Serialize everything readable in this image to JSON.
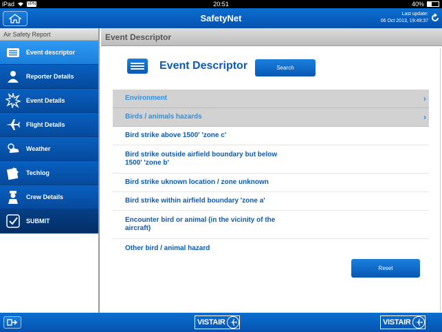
{
  "statusbar": {
    "device": "iPad",
    "vpn": "VPN",
    "time": "20:51",
    "battery": "40%",
    "battery_level": 0.4
  },
  "topbar": {
    "title": "SafetyNet",
    "update_label": "Last update:",
    "update_value": "06 Oct 2013, 19:49:37"
  },
  "sidebar": {
    "header": "Air Safety Report",
    "items": [
      {
        "label": "Event descriptor",
        "icon": "list-icon"
      },
      {
        "label": "Reporter Details",
        "icon": "reporter-icon"
      },
      {
        "label": "Event Details",
        "icon": "event-burst-icon"
      },
      {
        "label": "Flight Details",
        "icon": "airplane-icon"
      },
      {
        "label": "Weather",
        "icon": "weather-icon"
      },
      {
        "label": "Techlog",
        "icon": "techlog-icon"
      },
      {
        "label": "Crew Details",
        "icon": "crew-icon"
      },
      {
        "label": "SUBMIT",
        "icon": "checkbox-icon"
      }
    ]
  },
  "main": {
    "header": "Event Descriptor",
    "title": "Event Descriptor",
    "search_label": "Search",
    "reset_label": "Reset",
    "rows": [
      {
        "label": "Environment"
      },
      {
        "label": "Birds / animals hazards"
      },
      {
        "label": "Bird strike above 1500' 'zone c'"
      },
      {
        "label": "Bird strike outside airfield boundary but below 1500' 'zone b'"
      },
      {
        "label": "Bird strike uknown location / zone unknown"
      },
      {
        "label": "Bird strike within airfield boundary 'zone a'"
      },
      {
        "label": "Encounter bird or animal (in the vicinity of the aircraft)"
      },
      {
        "label": "Other bird / animal hazard"
      }
    ]
  },
  "bottombar": {
    "logo_text": "VISTAIR"
  },
  "colors": {
    "brand_blue": "#0552b0",
    "active_blue": "#1a7fdc",
    "title_blue": "#0b5ab0"
  }
}
